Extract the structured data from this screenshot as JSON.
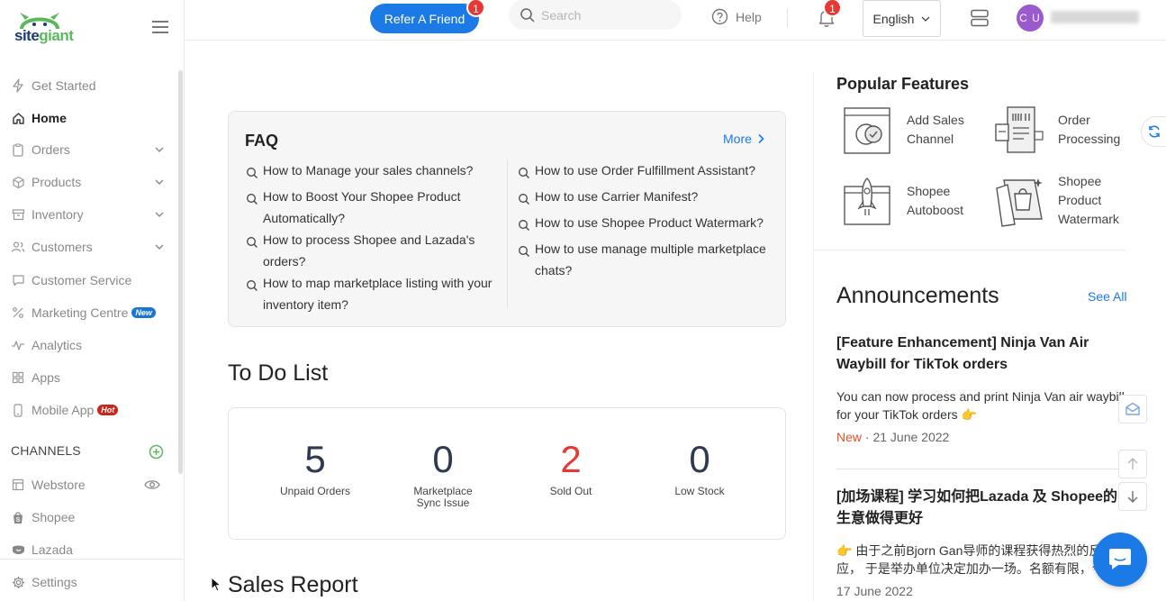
{
  "brand": {
    "logo_text_1": "site",
    "logo_text_2": "giant"
  },
  "sidebar": {
    "items": [
      {
        "label": "Get Started",
        "icon": "bolt-icon"
      },
      {
        "label": "Home",
        "icon": "home-icon"
      },
      {
        "label": "Orders",
        "icon": "clipboard-icon"
      },
      {
        "label": "Products",
        "icon": "box-icon"
      },
      {
        "label": "Inventory",
        "icon": "inventory-icon"
      },
      {
        "label": "Customers",
        "icon": "users-icon"
      },
      {
        "label": "Customer Service",
        "icon": "chat-icon"
      },
      {
        "label": "Marketing Centre",
        "icon": "percent-icon",
        "badge": "New"
      },
      {
        "label": "Analytics",
        "icon": "pulse-icon"
      },
      {
        "label": "Apps",
        "icon": "grid-icon"
      },
      {
        "label": "Mobile App",
        "icon": "phone-icon",
        "badge": "Hot"
      }
    ],
    "channels_heading": "CHANNELS",
    "channels": [
      {
        "label": "Webstore",
        "icon": "webstore-icon"
      },
      {
        "label": "Shopee",
        "icon": "shopee-icon"
      },
      {
        "label": "Lazada",
        "icon": "lazada-icon"
      }
    ],
    "settings_label": "Settings"
  },
  "topbar": {
    "refer_label": "Refer A Friend",
    "refer_badge": "1",
    "search_placeholder": "Search",
    "help_label": "Help",
    "notification_badge": "1",
    "language": "English",
    "avatar_initials": "C U"
  },
  "faq": {
    "title": "FAQ",
    "more_label": "More",
    "left": [
      "How to Manage your sales channels?",
      "How to Boost Your Shopee Product Automatically?",
      "How to process Shopee and Lazada's orders?",
      "How to map marketplace listing with your inventory item?"
    ],
    "right": [
      "How to use Order Fulfillment Assistant?",
      "How to use Carrier Manifest?",
      "How to use Shopee Product Watermark?",
      "How to use manage multiple marketplace chats?"
    ]
  },
  "todo": {
    "title": "To Do List",
    "items": [
      {
        "value": "5",
        "label": "Unpaid Orders"
      },
      {
        "value": "0",
        "label": "Marketplace Sync Issue"
      },
      {
        "value": "2",
        "label": "Sold Out"
      },
      {
        "value": "0",
        "label": "Low Stock"
      }
    ]
  },
  "sales_report_title": "Sales Report",
  "popular": {
    "title": "Popular Features",
    "features": [
      {
        "label": "Add Sales Channel"
      },
      {
        "label": "Order Processing"
      },
      {
        "label": "Shopee Autoboost"
      },
      {
        "label": "Shopee Product Watermark"
      }
    ]
  },
  "announcements": {
    "title": "Announcements",
    "see_all": "See All",
    "items": [
      {
        "title": "[Feature Enhancement] Ninja Van Air Waybill for TikTok orders",
        "body_1": "You can now process and print Ninja Van air waybill",
        "body_2": "for your TikTok orders 👉",
        "status": "New",
        "date": "21 June 2022"
      },
      {
        "title": "[加场课程] 学习如何把Lazada 及 Shopee的生意做得更好",
        "body_1": "👉 由于之前Bjorn Gan导师的课程获得热烈的反",
        "body_2": "应， 于是举办单位决定加办一场。名额有限，今",
        "date": "17 June 2022"
      }
    ]
  },
  "colors": {
    "accent": "#1b7ae6",
    "badge_red": "#e53935",
    "sold_out": "#e53935",
    "new_badge": "#1875d1",
    "hot_badge": "#c8261b",
    "brand_green": "#5cb85c"
  }
}
